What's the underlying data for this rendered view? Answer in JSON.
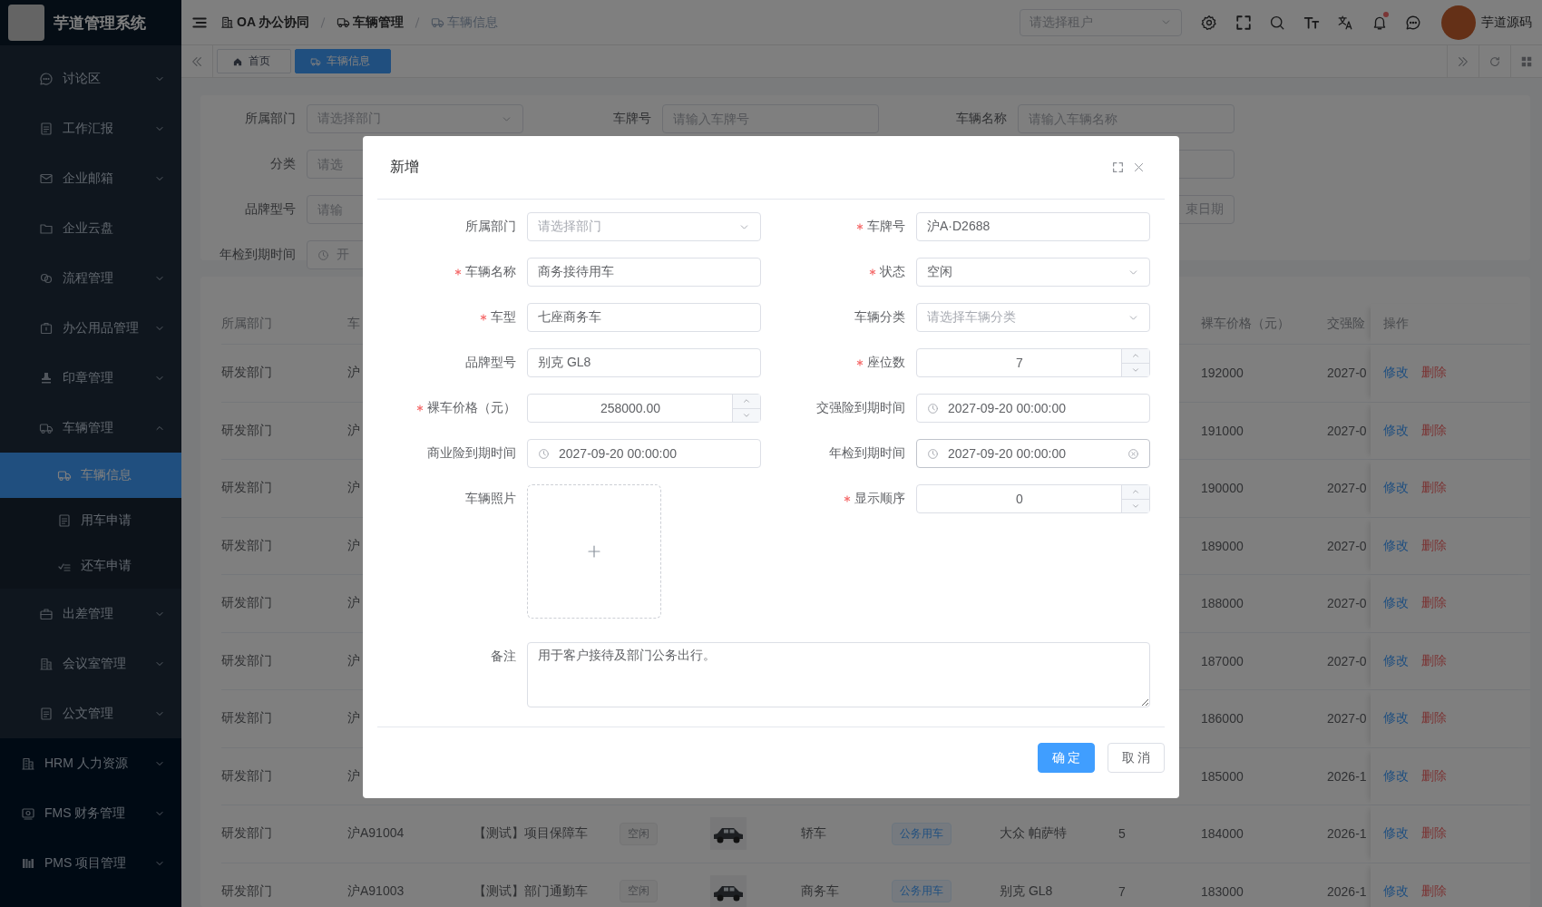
{
  "app": {
    "title": "芋道管理系统"
  },
  "sidebar": {
    "groups": [
      {
        "kind": "nested",
        "items": [
          {
            "label": "讨论区",
            "expanded": false
          },
          {
            "label": "工作汇报",
            "expanded": false
          },
          {
            "label": "企业邮箱",
            "expanded": false
          },
          {
            "label": "企业云盘"
          },
          {
            "label": "流程管理",
            "expanded": false
          },
          {
            "label": "办公用品管理",
            "expanded": false
          },
          {
            "label": "印章管理",
            "expanded": false
          },
          {
            "label": "车辆管理",
            "expanded": true,
            "children": [
              {
                "label": "车辆信息",
                "selected": true
              },
              {
                "label": "用车申请",
                "selected": false
              },
              {
                "label": "还车申请",
                "selected": false
              }
            ]
          },
          {
            "label": "出差管理",
            "expanded": false
          },
          {
            "label": "会议室管理",
            "expanded": false
          },
          {
            "label": "公文管理",
            "expanded": false
          }
        ]
      },
      {
        "kind": "root",
        "items": [
          {
            "label": "HRM 人力资源",
            "expanded": false
          },
          {
            "label": "FMS 财务管理",
            "expanded": false
          },
          {
            "label": "PMS 项目管理",
            "expanded": false
          }
        ]
      }
    ]
  },
  "header": {
    "breadcrumbs": [
      {
        "label": "OA 办公协同",
        "current": false
      },
      {
        "label": "车辆管理",
        "current": false
      },
      {
        "label": "车辆信息",
        "current": true
      }
    ],
    "tenant_select": {
      "placeholder": "请选择租户"
    },
    "notifications": {
      "unread": true
    },
    "user": {
      "name": "芋道源码"
    }
  },
  "tabs": [
    {
      "label": "首页",
      "selected": false
    },
    {
      "label": "车辆信息",
      "selected": true
    }
  ],
  "filters": {
    "rows": [
      {
        "fields": [
          {
            "label": "所属部门",
            "kind": "select",
            "placeholder": "请选择部门"
          },
          {
            "label": "车牌号",
            "kind": "input",
            "placeholder": "请输入车牌号"
          },
          {
            "label": "车辆名称",
            "kind": "input",
            "placeholder": "请输入车辆名称"
          }
        ]
      },
      {
        "fields": [
          {
            "label": "分类",
            "kind": "input",
            "placeholder": "请选"
          },
          {
            "kind": "input"
          }
        ]
      },
      {
        "fields": [
          {
            "label": "品牌型号",
            "kind": "input",
            "placeholder": "请输"
          },
          {
            "kind": "range-end",
            "placeholder": "束日期"
          }
        ]
      },
      {
        "fields": [
          {
            "label": "年检到期时间",
            "kind": "date",
            "placeholder": "开"
          }
        ]
      }
    ]
  },
  "table": {
    "columns": [
      {
        "label": "所属部门"
      },
      {
        "label": "车"
      },
      {},
      {},
      {},
      {},
      {},
      {},
      {},
      {
        "label": "裸车价格（元）"
      },
      {
        "label": "交强险"
      },
      {
        "label": "操作"
      }
    ],
    "rows": [
      {
        "cells": [
          "研发部门",
          "沪",
          null,
          null,
          null,
          null,
          null,
          null,
          null,
          "192000",
          "2027-0"
        ],
        "actions": [
          "修改",
          "删除"
        ]
      },
      {
        "cells": [
          "研发部门",
          "沪",
          null,
          null,
          null,
          null,
          null,
          null,
          null,
          "191000",
          "2027-0"
        ],
        "actions": [
          "修改",
          "删除"
        ]
      },
      {
        "cells": [
          "研发部门",
          "沪",
          null,
          null,
          null,
          null,
          null,
          null,
          null,
          "190000",
          "2027-0"
        ],
        "actions": [
          "修改",
          "删除"
        ]
      },
      {
        "cells": [
          "研发部门",
          "沪",
          null,
          null,
          null,
          null,
          null,
          null,
          null,
          "189000",
          "2027-0"
        ],
        "actions": [
          "修改",
          "删除"
        ]
      },
      {
        "cells": [
          "研发部门",
          "沪",
          null,
          null,
          null,
          null,
          null,
          null,
          null,
          "188000",
          "2027-0"
        ],
        "actions": [
          "修改",
          "删除"
        ]
      },
      {
        "cells": [
          "研发部门",
          "沪",
          null,
          null,
          null,
          null,
          null,
          null,
          null,
          "187000",
          "2027-0"
        ],
        "actions": [
          "修改",
          "删除"
        ]
      },
      {
        "cells": [
          "研发部门",
          "沪",
          null,
          null,
          null,
          null,
          null,
          null,
          null,
          "186000",
          "2027-0"
        ],
        "actions": [
          "修改",
          "删除"
        ]
      },
      {
        "cells": [
          "研发部门",
          "沪",
          null,
          null,
          null,
          null,
          null,
          null,
          null,
          "185000",
          "2026-1"
        ],
        "actions": [
          "修改",
          "删除"
        ]
      },
      {
        "cells": [
          "研发部门",
          "沪A91004",
          "【测试】项目保障车",
          "空闲",
          null,
          "轿车",
          "公务用车",
          "大众 帕萨特",
          "5",
          "184000",
          "2026-1"
        ],
        "photo": true,
        "actions": [
          "修改",
          "删除"
        ]
      },
      {
        "cells": [
          "研发部门",
          "沪A91003",
          "【测试】部门通勤车",
          "空闲",
          null,
          "商务车",
          "公务用车",
          "别克 GL8",
          "7",
          "183000",
          "2026-1"
        ],
        "photo": true,
        "actions": [
          "修改",
          "删除"
        ]
      }
    ]
  },
  "dialog": {
    "title": "新增",
    "fields": [
      {
        "label": "所属部门",
        "kind": "select",
        "required": false,
        "placeholder": "请选择部门"
      },
      {
        "label": "车牌号",
        "kind": "input",
        "required": true,
        "value": "沪A·D2688"
      },
      {
        "label": "车辆名称",
        "kind": "input",
        "required": true,
        "value": "商务接待用车"
      },
      {
        "label": "状态",
        "kind": "select",
        "required": true,
        "value": "空闲"
      },
      {
        "label": "车型",
        "kind": "input",
        "required": true,
        "value": "七座商务车"
      },
      {
        "label": "车辆分类",
        "kind": "select",
        "required": false,
        "placeholder": "请选择车辆分类"
      },
      {
        "label": "品牌型号",
        "kind": "input",
        "required": false,
        "value": "别克 GL8"
      },
      {
        "label": "座位数",
        "kind": "number",
        "required": true,
        "value": "7"
      },
      {
        "label": "裸车价格（元）",
        "kind": "number",
        "required": true,
        "value": "258000.00"
      },
      {
        "label": "交强险到期时间",
        "kind": "datetime",
        "required": false,
        "clearable": false,
        "value": "2027-09-20 00:00:00"
      },
      {
        "label": "商业险到期时间",
        "kind": "datetime",
        "required": false,
        "clearable": false,
        "value": "2027-09-20 00:00:00"
      },
      {
        "label": "年检到期时间",
        "kind": "datetime",
        "required": false,
        "clearable": true,
        "value": "2027-09-20 00:00:00"
      },
      {
        "label": "车辆照片",
        "kind": "upload",
        "required": false
      },
      {
        "label": "显示顺序",
        "kind": "number",
        "required": true,
        "value": "0"
      }
    ],
    "remark": {
      "label": "备注",
      "value": "用于客户接待及部门公务出行。"
    },
    "buttons": [
      {
        "label": "确 定",
        "kind": "primary"
      },
      {
        "label": "取 消",
        "kind": "default"
      }
    ]
  }
}
